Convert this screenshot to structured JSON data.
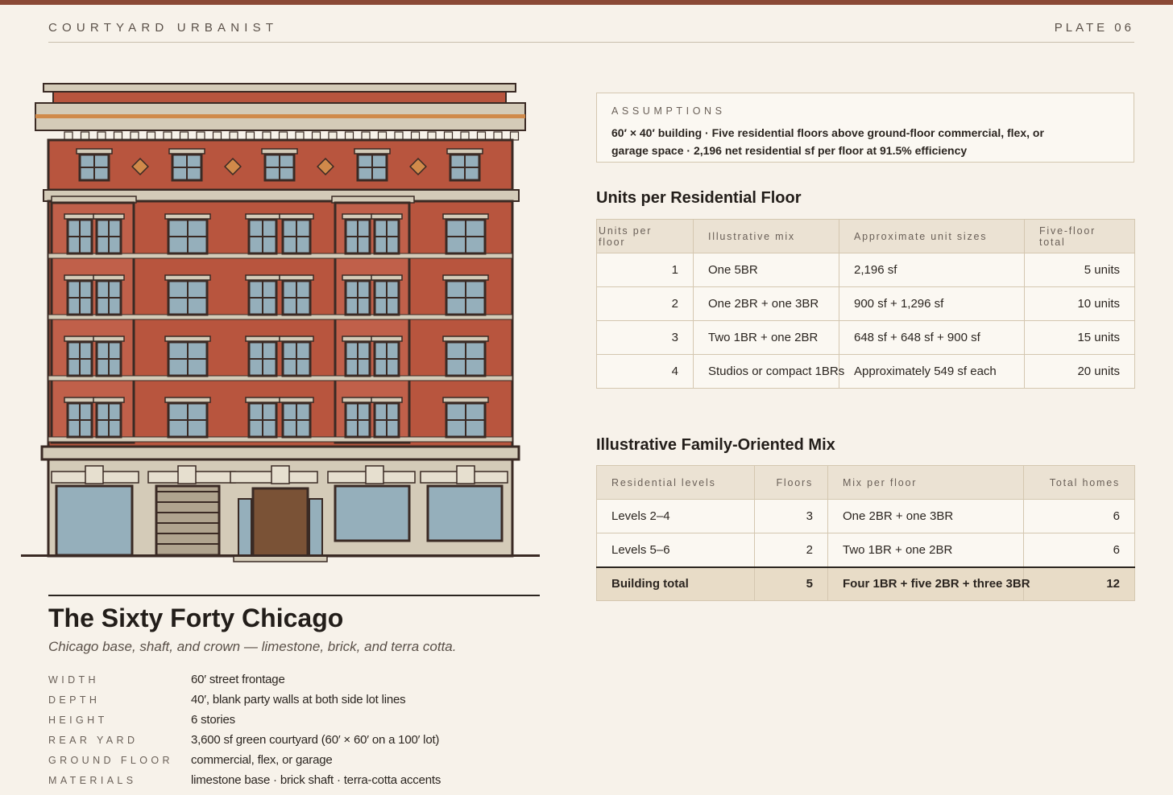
{
  "header": {
    "brand": "COURTYARD URBANIST",
    "plate": "PLATE 06"
  },
  "building": {
    "title": "The Sixty Forty Chicago",
    "subtitle": "Chicago base, shaft, and crown — limestone, brick, and terra cotta.",
    "specs": [
      {
        "label": "WIDTH",
        "value": "60′ street frontage"
      },
      {
        "label": "DEPTH",
        "value": "40′, blank party walls at both side lot lines"
      },
      {
        "label": "HEIGHT",
        "value": "6 stories"
      },
      {
        "label": "REAR YARD",
        "value": "3,600 sf green courtyard (60′ × 60′ on a 100′ lot)"
      },
      {
        "label": "GROUND FLOOR",
        "value": "commercial, flex, or garage"
      },
      {
        "label": "MATERIALS",
        "value": "limestone base · brick shaft · terra-cotta accents"
      }
    ]
  },
  "colors": {
    "brick": "#b8553e",
    "limestone": "#d4cbb8",
    "terracotta": "#d08a4a",
    "glass": "#95afbb",
    "accent_rule": "#8b4a36"
  },
  "assumptions": {
    "label": "ASSUMPTIONS",
    "text": "60′ × 40′ building · Five residential floors above ground-floor commercial, flex, or garage space · 2,196 net residential sf per floor at 91.5% efficiency"
  },
  "units_section": {
    "title": "Units per Residential Floor",
    "headers": [
      "Units per floor",
      "Illustrative mix",
      "Approximate unit sizes",
      "Five-floor total"
    ],
    "rows": [
      [
        "1",
        "One 5BR",
        "2,196 sf",
        "5 units"
      ],
      [
        "2",
        "One 2BR + one 3BR",
        "900 sf + 1,296 sf",
        "10 units"
      ],
      [
        "3",
        "Two 1BR + one 2BR",
        "648 sf + 648 sf + 900 sf",
        "15 units"
      ],
      [
        "4",
        "Studios or compact 1BRs",
        "Approximately 549 sf each",
        "20 units"
      ]
    ]
  },
  "mix_section": {
    "title": "Illustrative Family-Oriented Mix",
    "headers": [
      "Residential levels",
      "Floors",
      "Mix per floor",
      "Total homes"
    ],
    "rows": [
      [
        "Levels 2–4",
        "3",
        "One 2BR + one 3BR",
        "6"
      ],
      [
        "Levels 5–6",
        "2",
        "Two 1BR + one 2BR",
        "6"
      ]
    ],
    "total": [
      "Building total",
      "5",
      "Four 1BR + five 2BR + three 3BR",
      "12"
    ]
  }
}
